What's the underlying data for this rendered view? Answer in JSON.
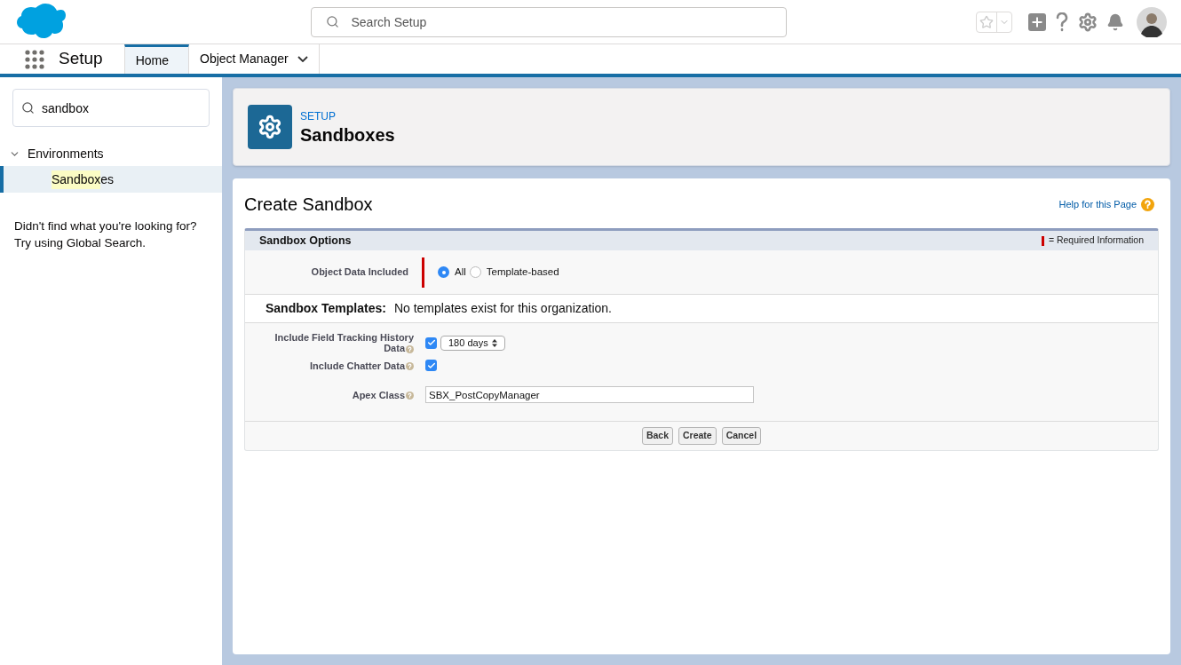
{
  "header": {
    "search": {
      "placeholder": "Search Setup"
    }
  },
  "nav": {
    "app_name": "Setup",
    "tabs": [
      {
        "label": "Home",
        "selected": true,
        "dropdown": false
      },
      {
        "label": "Object Manager",
        "selected": false,
        "dropdown": true
      }
    ]
  },
  "sidebar": {
    "search": {
      "value": "sandbox"
    },
    "tree": [
      {
        "label": "Environments",
        "expanded": true,
        "selected": false,
        "children": [
          {
            "match": "Sandbox",
            "rest": "es",
            "selected": true
          }
        ]
      }
    ],
    "hint": [
      "Didn't find what you're looking for?",
      "Try using Global Search."
    ]
  },
  "page_header": {
    "eyebrow": "SETUP",
    "title": "Sandboxes"
  },
  "content": {
    "title": "Create Sandbox",
    "help_link": "Help for this Page",
    "section": {
      "title": "Sandbox Options",
      "required_legend": "= Required Information"
    },
    "object_data": {
      "label": "Object Data Included",
      "options": [
        {
          "label": "All",
          "selected": true
        },
        {
          "label": "Template-based",
          "selected": false
        }
      ]
    },
    "templates": {
      "label": "Sandbox Templates:",
      "message": "No templates exist for this organization."
    },
    "fields": [
      {
        "kind": "checkbox-select",
        "label_lines": [
          "Include Field Tracking History",
          "Data"
        ],
        "checked": true,
        "select": "180 days"
      },
      {
        "kind": "checkbox",
        "label_lines": [
          "Include Chatter Data"
        ],
        "checked": true
      },
      {
        "kind": "text",
        "label_lines": [
          "Apex Class"
        ],
        "value": "SBX_PostCopyManager"
      }
    ],
    "buttons": [
      "Back",
      "Create",
      "Cancel"
    ]
  }
}
